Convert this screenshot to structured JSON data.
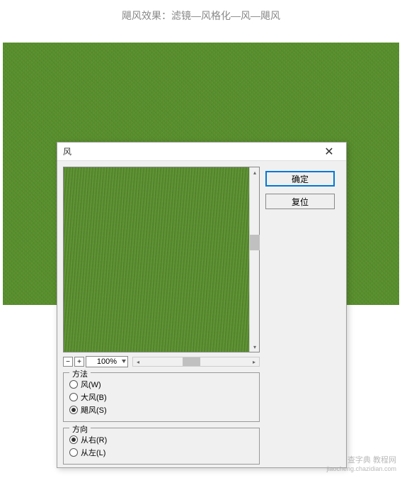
{
  "instruction": "飓风效果：滤镜—风格化—风—飓风",
  "dialog": {
    "title": "风",
    "ok_label": "确定",
    "reset_label": "复位",
    "zoom_value": "100%"
  },
  "method_group": {
    "legend": "方法",
    "options": [
      {
        "label": "风(W)",
        "checked": false
      },
      {
        "label": "大风(B)",
        "checked": false
      },
      {
        "label": "飓风(S)",
        "checked": true
      }
    ]
  },
  "direction_group": {
    "legend": "方向",
    "options": [
      {
        "label": "从右(R)",
        "checked": true
      },
      {
        "label": "从左(L)",
        "checked": false
      }
    ]
  },
  "watermark": {
    "main": "查字典 教程网",
    "sub": "jiaocheng.chazidian.com"
  }
}
